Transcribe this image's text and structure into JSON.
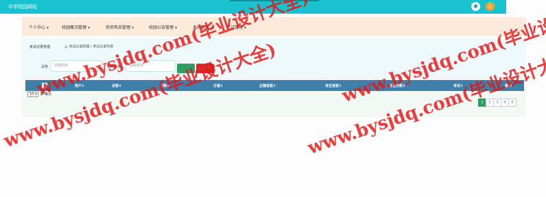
{
  "app": {
    "title": "中学校园网站"
  },
  "nav": {
    "items": [
      {
        "label": "个人中心"
      },
      {
        "label": "校园概况管理"
      },
      {
        "label": "名师风采管理"
      },
      {
        "label": "校园公告管理"
      },
      {
        "label": "系统管理"
      },
      {
        "label": "考试管理"
      }
    ]
  },
  "breadcrumb": {
    "title": "考试记录管理",
    "path": "考试记录管理 / 考试记录列表"
  },
  "search": {
    "fields": [
      {
        "label": "试卷",
        "placeholder": "试卷名称"
      },
      {
        "label": "试题名称",
        "placeholder": "试题名称"
      }
    ]
  },
  "table": {
    "columns": [
      "用户",
      "试卷",
      "试题",
      "分值",
      "正确答案",
      "考生答案",
      "考生分数",
      "考试",
      "操作"
    ]
  },
  "pagination": {
    "page_size": "10",
    "page_size_suffix": "条 每页",
    "pages": [
      "1",
      "2",
      "3",
      "4",
      "5"
    ],
    "active_page": "1"
  },
  "watermark": {
    "text": "www.bysjdq.com(毕业设计大全)"
  },
  "colors": {
    "topbar": "#19c2cf",
    "navbar": "#fdeadb",
    "table_header": "#3f7fa8",
    "search_button": "#2e9f63",
    "delete_button": "#d42f2f",
    "watermark": "#e61414"
  }
}
